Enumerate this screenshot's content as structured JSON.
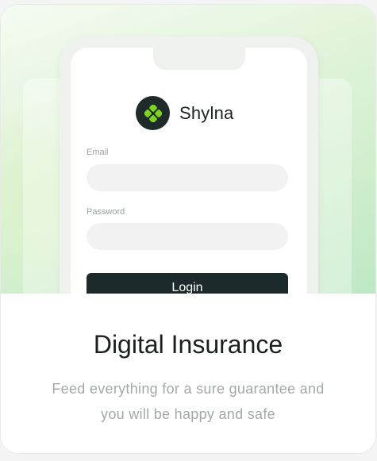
{
  "app": {
    "brand_name": "Shylna",
    "logo_icon": "clover-icon"
  },
  "form": {
    "email_label": "Email",
    "email_value": "",
    "password_label": "Password",
    "password_value": "",
    "login_label": "Login"
  },
  "card": {
    "title": "Digital Insurance",
    "description_line1": "Feed everything for a sure guarantee and",
    "description_line2": "you will be happy and safe"
  },
  "colors": {
    "accent_green": "#7ed321",
    "button_dark": "#1d2a2c",
    "hero_gradient": [
      "#f5fbf2",
      "#bde8c4"
    ]
  }
}
